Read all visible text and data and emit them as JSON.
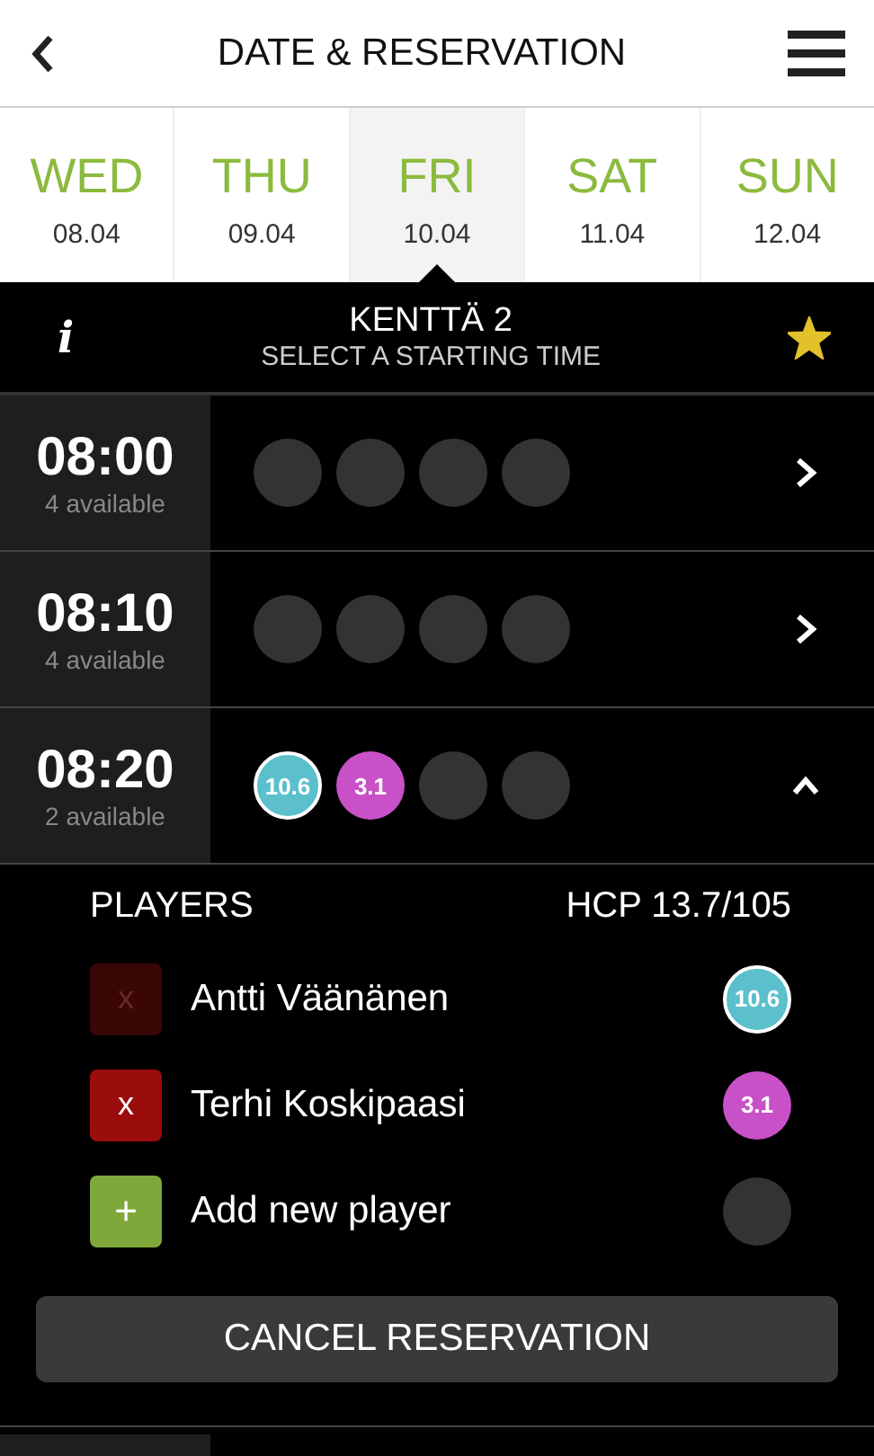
{
  "header": {
    "title": "DATE & RESERVATION"
  },
  "days": [
    {
      "day": "WED",
      "date": "08.04",
      "selected": false
    },
    {
      "day": "THU",
      "date": "09.04",
      "selected": false
    },
    {
      "day": "FRI",
      "date": "10.04",
      "selected": true
    },
    {
      "day": "SAT",
      "date": "11.04",
      "selected": false
    },
    {
      "day": "SUN",
      "date": "12.04",
      "selected": false
    }
  ],
  "course": {
    "info": "i",
    "name": "KENTTÄ 2",
    "subtitle": "SELECT A STARTING TIME",
    "favorite": true
  },
  "slots": [
    {
      "time": "08:00",
      "available": "4 available",
      "expanded": false,
      "spots": [
        {
          "kind": "empty"
        },
        {
          "kind": "empty"
        },
        {
          "kind": "empty"
        },
        {
          "kind": "empty"
        }
      ]
    },
    {
      "time": "08:10",
      "available": "4 available",
      "expanded": false,
      "spots": [
        {
          "kind": "empty"
        },
        {
          "kind": "empty"
        },
        {
          "kind": "empty"
        },
        {
          "kind": "empty"
        }
      ]
    },
    {
      "time": "08:20",
      "available": "2 available",
      "expanded": true,
      "spots": [
        {
          "kind": "player",
          "hcp": "10.6",
          "color": "#5bbfcc",
          "outlined": true
        },
        {
          "kind": "player",
          "hcp": "3.1",
          "color": "#c851c8",
          "outlined": false
        },
        {
          "kind": "empty"
        },
        {
          "kind": "empty"
        }
      ]
    }
  ],
  "players_panel": {
    "heading": "PLAYERS",
    "hcp": "HCP 13.7/105",
    "rows": [
      {
        "kind": "player",
        "button": "x",
        "name": "Antti Väänänen",
        "disabled": true,
        "hcp": "10.6",
        "color": "#5bbfcc",
        "outlined": true
      },
      {
        "kind": "player",
        "button": "x",
        "name": "Terhi Koskipaasi",
        "disabled": false,
        "hcp": "3.1",
        "color": "#c851c8",
        "outlined": false
      },
      {
        "kind": "add",
        "button": "+",
        "name": "Add new player"
      }
    ],
    "cancel": "CANCEL RESERVATION"
  }
}
